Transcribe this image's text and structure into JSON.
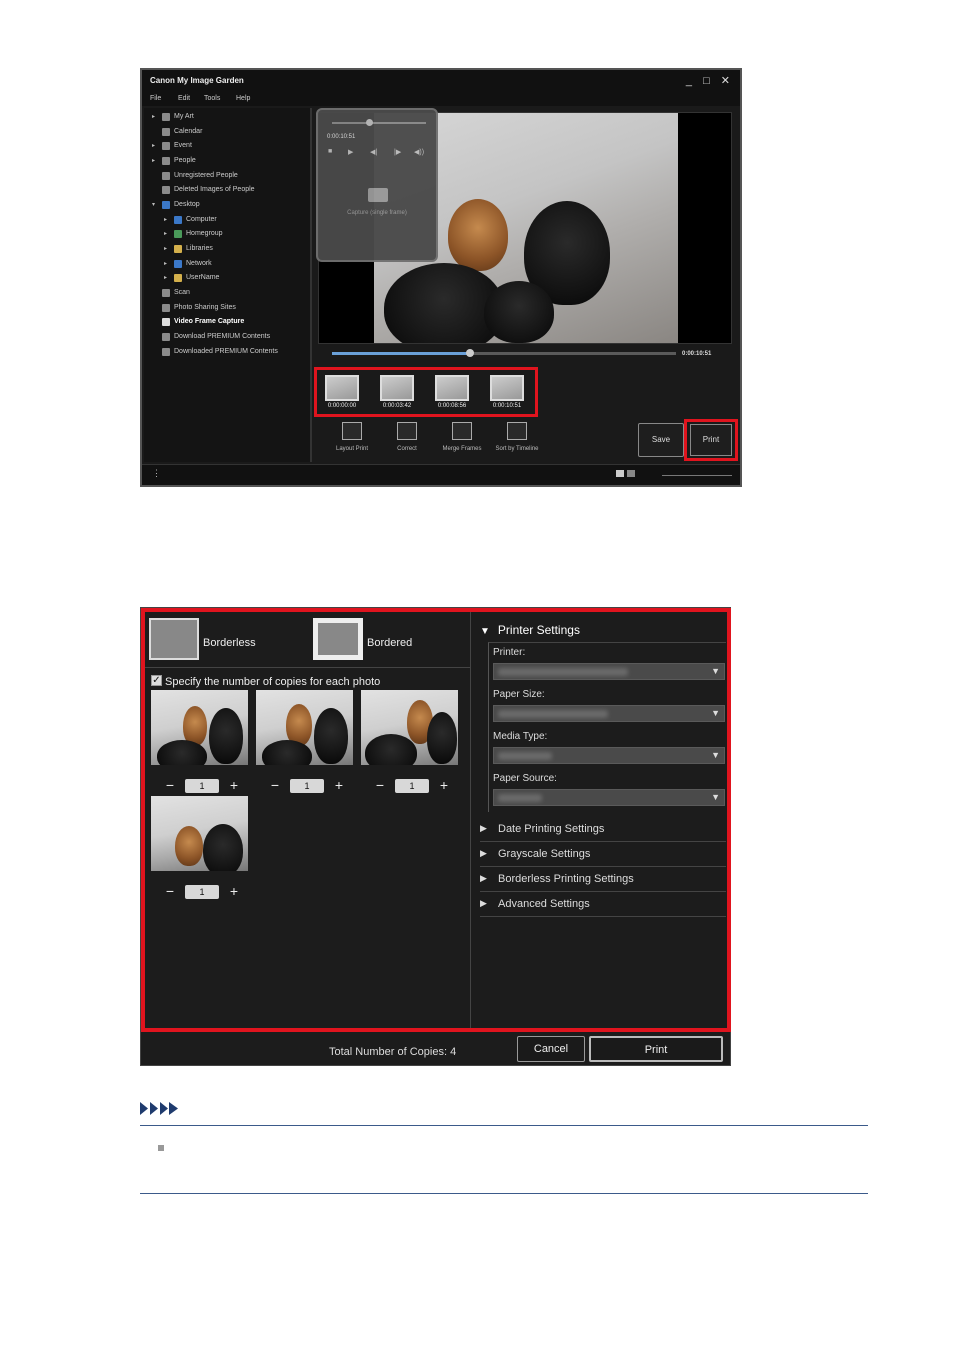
{
  "window1": {
    "title": "Canon My Image Garden",
    "window_controls": "_ □ ✕",
    "menu": [
      "File",
      "Edit",
      "Tools",
      "Help"
    ],
    "sidebar": [
      {
        "label": "My Art",
        "expand": "▸",
        "level": 0
      },
      {
        "label": "Calendar",
        "expand": "",
        "level": 0
      },
      {
        "label": "Event",
        "expand": "▸",
        "level": 0
      },
      {
        "label": "People",
        "expand": "▸",
        "level": 0
      },
      {
        "label": "Unregistered People",
        "expand": "",
        "level": 0
      },
      {
        "label": "Deleted Images of People",
        "expand": "",
        "level": 0
      },
      {
        "label": "Desktop",
        "expand": "▾",
        "level": 0
      },
      {
        "label": "Computer",
        "expand": "▸",
        "level": 1
      },
      {
        "label": "Homegroup",
        "expand": "▸",
        "level": 1
      },
      {
        "label": "Libraries",
        "expand": "▸",
        "level": 1
      },
      {
        "label": "Network",
        "expand": "▸",
        "level": 1
      },
      {
        "label": "UserName",
        "expand": "▸",
        "level": 1
      },
      {
        "label": "Scan",
        "expand": "",
        "level": 0
      },
      {
        "label": "Photo Sharing Sites",
        "expand": "",
        "level": 0
      },
      {
        "label": "Video Frame Capture",
        "expand": "",
        "level": 0,
        "selected": true
      },
      {
        "label": "Download PREMIUM Contents",
        "expand": "",
        "level": 0
      },
      {
        "label": "Downloaded PREMIUM Contents",
        "expand": "",
        "level": 0
      }
    ],
    "popup": {
      "time": "0:00:10:51",
      "capture_label": "Capture (single frame)",
      "playback_buttons": [
        "■",
        "▶",
        "◀|",
        "|▶",
        "◀))"
      ]
    },
    "timeline": {
      "time": "0:00:10:51",
      "progress": 0.4
    },
    "frames": [
      "0:00:00:00",
      "0:00:03:42",
      "0:00:08:56",
      "0:00:10:51"
    ],
    "tools": [
      {
        "label": "Layout Print"
      },
      {
        "label": "Correct"
      },
      {
        "label": "Merge Frames"
      },
      {
        "label": "Sort by Timeline"
      }
    ],
    "save_label": "Save",
    "print_label": "Print",
    "status_icon": "⋮"
  },
  "window2": {
    "borderless_label": "Borderless",
    "bordered_label": "Bordered",
    "copies_checkbox_label": "Specify the number of copies for each photo",
    "copies_checked": "✓",
    "copies": [
      "1",
      "1",
      "1",
      "1"
    ],
    "stepper_minus": "−",
    "stepper_plus": "+",
    "printer_settings_label": "Printer Settings",
    "fields": [
      {
        "label": "Printer:"
      },
      {
        "label": "Paper Size:"
      },
      {
        "label": "Media Type:"
      },
      {
        "label": "Paper Source:"
      }
    ],
    "accordions": [
      "Date Printing Settings",
      "Grayscale Settings",
      "Borderless Printing Settings",
      "Advanced Settings"
    ],
    "total_label": "Total Number of Copies:",
    "total_value": "4",
    "cancel_label": "Cancel",
    "print_label": "Print"
  },
  "colors": {
    "highlight": "#e0141e",
    "accent_blue": "#3b78c8",
    "note_line": "#3b5a8a"
  }
}
